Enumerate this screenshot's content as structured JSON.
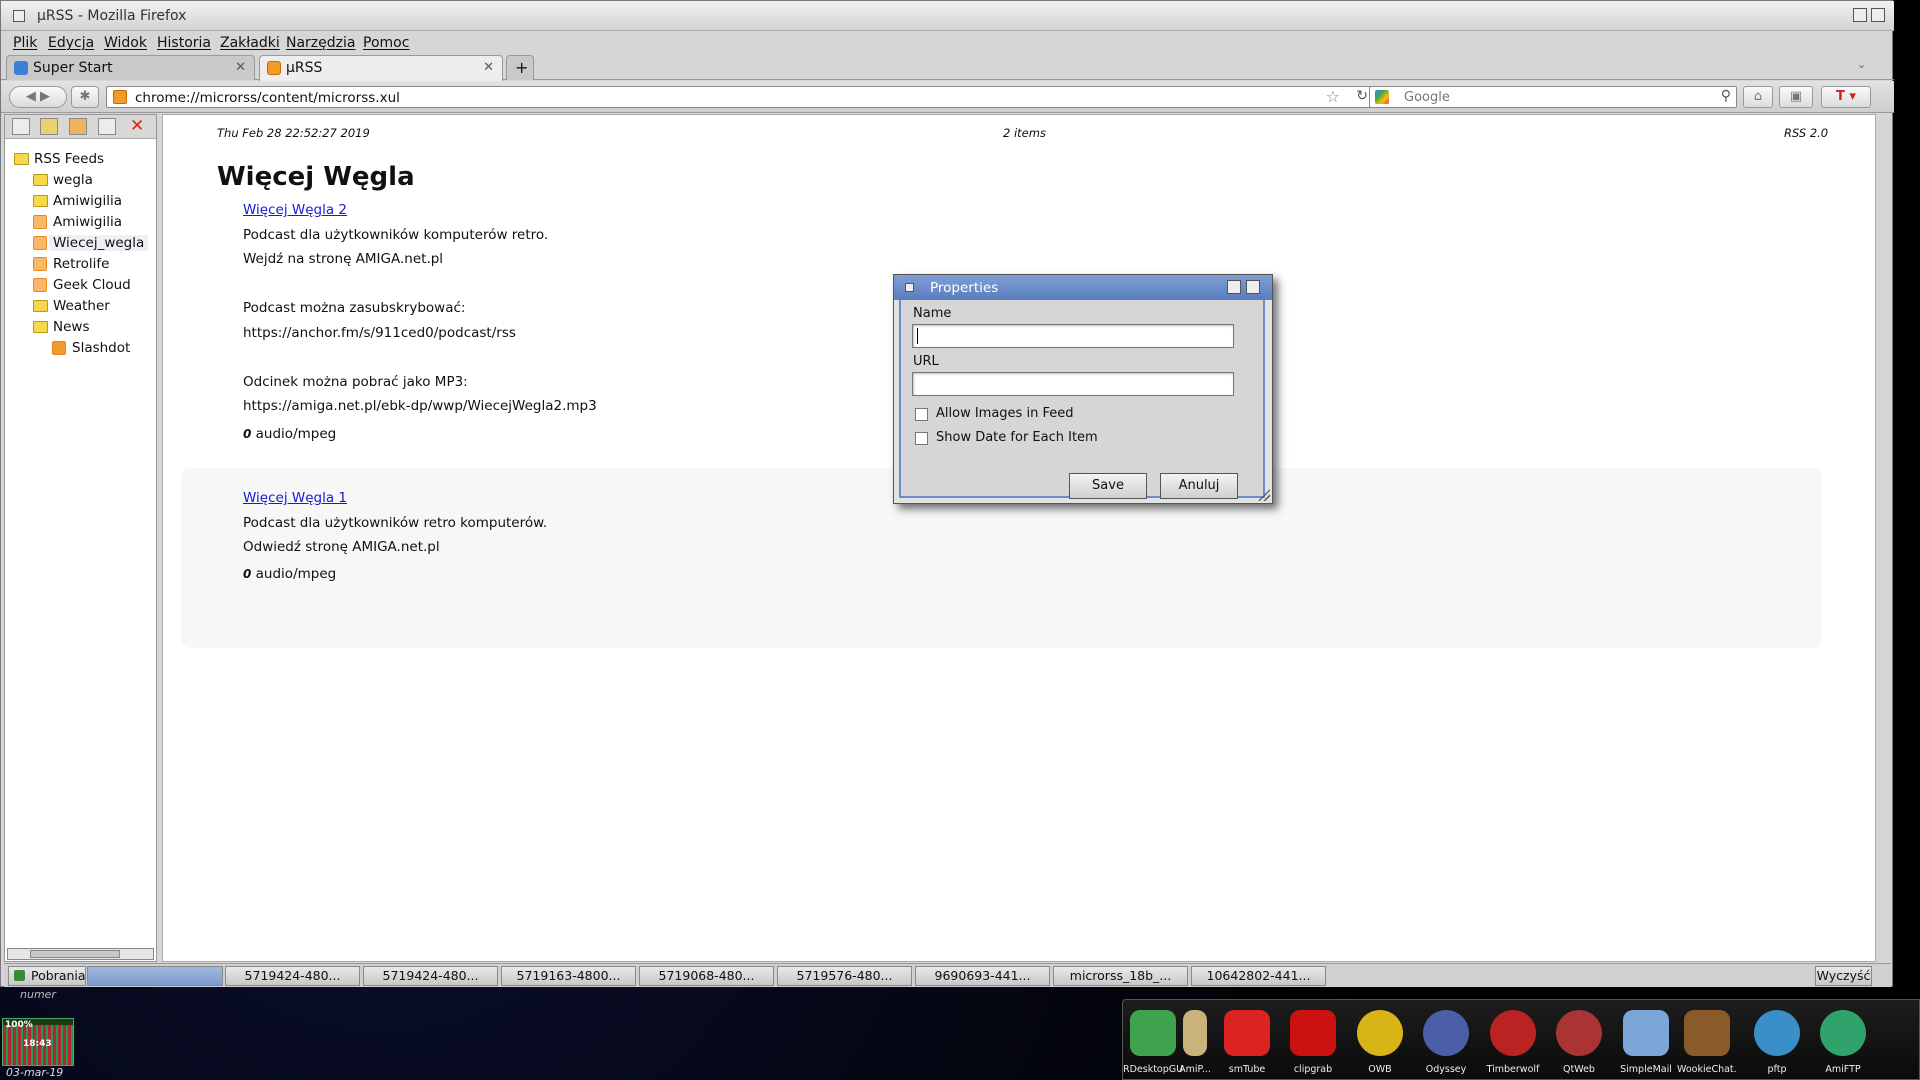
{
  "window": {
    "title": "μRSS - Mozilla Firefox"
  },
  "menu": [
    "Plik",
    "Edycja",
    "Widok",
    "Historia",
    "Zakładki",
    "Narzędzia",
    "Pomoc"
  ],
  "tabs": [
    {
      "label": "Super Start",
      "active": false
    },
    {
      "label": "μRSS",
      "active": true
    }
  ],
  "nav": {
    "url": "chrome://microrss/content/microrss.xul",
    "search_placeholder": "Google"
  },
  "sidebar": {
    "root": "RSS Feeds",
    "items": [
      {
        "label": "wegla",
        "type": "folder"
      },
      {
        "label": "Amiwigilia",
        "type": "folder"
      },
      {
        "label": "Amiwigilia",
        "type": "feed"
      },
      {
        "label": "Wiecej_wegla",
        "type": "feed",
        "selected": true
      },
      {
        "label": "Retrolife",
        "type": "feed"
      },
      {
        "label": "Geek Cloud",
        "type": "feed"
      },
      {
        "label": "Weather",
        "type": "folder"
      },
      {
        "label": "News",
        "type": "folder"
      }
    ],
    "child": {
      "label": "Slashdot",
      "type": "feed"
    }
  },
  "feed": {
    "date": "Thu Feb 28 22:52:27 2019",
    "count": "2 items",
    "format": "RSS 2.0",
    "title": "Więcej Węgla",
    "items": [
      {
        "title": "Więcej Węgla 2",
        "lines": [
          "Podcast dla użytkowników komputerów retro.",
          "Wejdź na stronę AMIGA.net.pl",
          "Podcast można zasubskrybować:",
          "https://anchor.fm/s/911ced0/podcast/rss",
          "Odcinek można pobrać jako MP3:",
          "https://amiga.net.pl/ebk-dp/wwp/WiecejWegla2.mp3"
        ],
        "enclosure_icon": "0",
        "enclosure": "audio/mpeg"
      },
      {
        "title": "Więcej Węgla 1",
        "lines": [
          "Podcast dla użytkowników retro komputerów.",
          "Odwiedź stronę AMIGA.net.pl"
        ],
        "enclosure_icon": "0",
        "enclosure": "audio/mpeg"
      }
    ]
  },
  "dialog": {
    "title": "Properties",
    "name_label": "Name",
    "url_label": "URL",
    "name_value": "",
    "url_value": "",
    "allow_images_label": "Allow Images in Feed",
    "show_date_label": "Show Date for Each Item",
    "save": "Save",
    "cancel": "Anuluj"
  },
  "downloads": {
    "label": "Pobrania",
    "files": [
      "5719424-480...",
      "5719424-480...",
      "5719163-4800...",
      "5719068-480...",
      "5719576-480...",
      "9690693-441...",
      "microrss_18b_...",
      "10642802-441..."
    ],
    "clear": "Wyczyść"
  },
  "desktop": {
    "numer": "numer",
    "cpu": "100%",
    "time": "18:43",
    "date": "03-mar-19",
    "dock": [
      {
        "label": "RDesktopGUI",
        "color": "#3fa34d"
      },
      {
        "label": "AmiP...",
        "color": "#c9b37a"
      },
      {
        "label": "smTube",
        "color": "#d22"
      },
      {
        "label": "clipgrab",
        "color": "#c11"
      },
      {
        "label": "OWB",
        "color": "#d8b416"
      },
      {
        "label": "Odyssey",
        "color": "#4a5fa8"
      },
      {
        "label": "Timberwolf",
        "color": "#b22"
      },
      {
        "label": "QtWeb",
        "color": "#a33"
      },
      {
        "label": "SimpleMail",
        "color": "#7aa6d8"
      },
      {
        "label": "WookieChat...",
        "color": "#8a5a2a"
      },
      {
        "label": "pftp",
        "color": "#3a8fc9"
      },
      {
        "label": "AmiFTP",
        "color": "#2fa36b"
      }
    ]
  },
  "colors": {
    "accent": "#5a7dbe",
    "link": "#1a1ad1",
    "rss": "#f29b2a"
  }
}
